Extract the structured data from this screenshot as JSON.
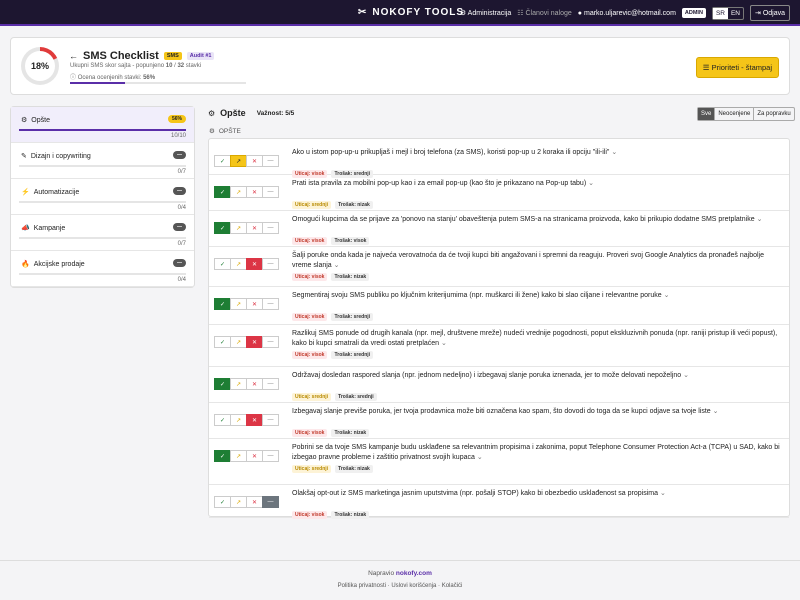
{
  "topbar": {
    "logo": "NOKOFY TOOLS",
    "admin_link": "Administracija",
    "members_link": "Članovi naloge",
    "email": "marko.uljarevic@hotmail.com",
    "role": "ADMIN",
    "lang_sr": "SR",
    "lang_en": "EN",
    "logout": "Odjava"
  },
  "header": {
    "percent": "18%",
    "progress_fraction": 0.31,
    "title": "SMS Checklist",
    "tag": "SMS",
    "audit": "Audit #1",
    "subtitle_prefix": "Ukupni SMS skor sajta - popunjeno",
    "filled": "10",
    "total": "32",
    "subtitle_suffix": "stavki",
    "rated_prefix": "Ocena ocenjenih stavki:",
    "rated_value": "56%",
    "print_button": "Prioriteti - štampaj"
  },
  "sidebar": {
    "items": [
      {
        "name": "Opšte",
        "pill": "56%",
        "count": "10/10",
        "progress": 1.0
      },
      {
        "name": "Dizajn i copywriting",
        "pill": "—",
        "count": "0/7",
        "progress": 0
      },
      {
        "name": "Automatizacije",
        "pill": "—",
        "count": "0/4",
        "progress": 0
      },
      {
        "name": "Kampanje",
        "pill": "—",
        "count": "0/7",
        "progress": 0
      },
      {
        "name": "Akcijske prodaje",
        "pill": "—",
        "count": "0/4",
        "progress": 0
      }
    ]
  },
  "section": {
    "title": "Opšte",
    "importance": "Važnost: 5/5",
    "subheading": "OPŠTE",
    "filters": [
      "Sve",
      "Neocenjene",
      "Za popravku"
    ]
  },
  "items": [
    {
      "text": "Ako u istom pop-up-u prikupljaš i mejl i broj telefona (za SMS), koristi pop-up u 2 koraka ili opciju \"ili-ili\"",
      "state": "partial",
      "impact": "Uticaj: visok",
      "cost": "Trošak: srednji"
    },
    {
      "text": "Prati ista pravila za mobilni pop-up kao i za email pop-up (kao što je prikazano na Pop-up tabu)",
      "state": "ok",
      "impact": "Uticaj: srednji",
      "cost": "Trošak: nizak"
    },
    {
      "text": "Omogući kupcima da se prijave za 'ponovo na stanju' obaveštenja putem SMS-a na stranicama proizvoda, kako bi prikupio dodatne SMS pretplatnike",
      "state": "ok",
      "impact": "Uticaj: visok",
      "cost": "Trošak: visok"
    },
    {
      "text": "Šalji poruke onda kada je najveća verovatnoća da će tvoji kupci biti angažovani i spremni da reaguju. Proveri svoj Google Analytics da pronađeš najbolje vreme slanja",
      "state": "no",
      "impact": "Uticaj: visok",
      "cost": "Trošak: nizak"
    },
    {
      "text": "Segmentiraj svoju SMS publiku po ključnim kriterijumima (npr. muškarci ili žene) kako bi slao ciljane i relevantne poruke",
      "state": "ok",
      "impact": "Uticaj: visok",
      "cost": "Trošak: srednji"
    },
    {
      "text": "Razlikuj SMS ponude od drugih kanala (npr. mejl, društvene mreže) nudeći vrednije pogodnosti, poput ekskluzivnih ponuda (npr. raniji pristup ili veći popust), kako bi kupci smatrali da vredi ostati pretplaćen",
      "state": "no",
      "impact": "Uticaj: visok",
      "cost": "Trošak: srednji"
    },
    {
      "text": "Održavaj dosledan raspored slanja (npr. jednom nedeljno) i izbegavaj slanje poruka iznenada, jer to može delovati nepoželjno",
      "state": "ok",
      "impact": "Uticaj: srednji",
      "cost": "Trošak: srednji"
    },
    {
      "text": "Izbegavaj slanje previše poruka, jer tvoja prodavnica može biti označena kao spam, što dovodi do toga da se kupci odjave sa tvoje liste",
      "state": "no",
      "impact": "Uticaj: visok",
      "cost": "Trošak: nizak"
    },
    {
      "text": "Pobrini se da tvoje SMS kampanje budu usklađene sa relevantnim propisima i zakonima, poput Telephone Consumer Protection Act-a (TCPA) u SAD, kako bi izbegao pravne probleme i zaštitio privatnost svojih kupaca",
      "state": "ok",
      "impact": "Uticaj: srednji",
      "cost": "Trošak: nizak"
    },
    {
      "text": "Olakšaj opt-out iz SMS marketinga jasnim uputstvima (npr. pošalji STOP) kako bi obezbedio usklađenost sa propisima",
      "state": "na",
      "impact": "Uticaj: visok",
      "cost": "Trošak: nizak"
    }
  ],
  "footer": {
    "made_by": "Napravio",
    "brand": "nokofy.com",
    "privacy": "Politika privatnosti",
    "terms": "Uslovi korišćenja",
    "cookies": "Kolačići"
  },
  "colors": {
    "brand": "#5a2ea8",
    "accent": "#f5c518",
    "ok": "#1e7e34",
    "no": "#dc3545",
    "na": "#6c757d"
  }
}
